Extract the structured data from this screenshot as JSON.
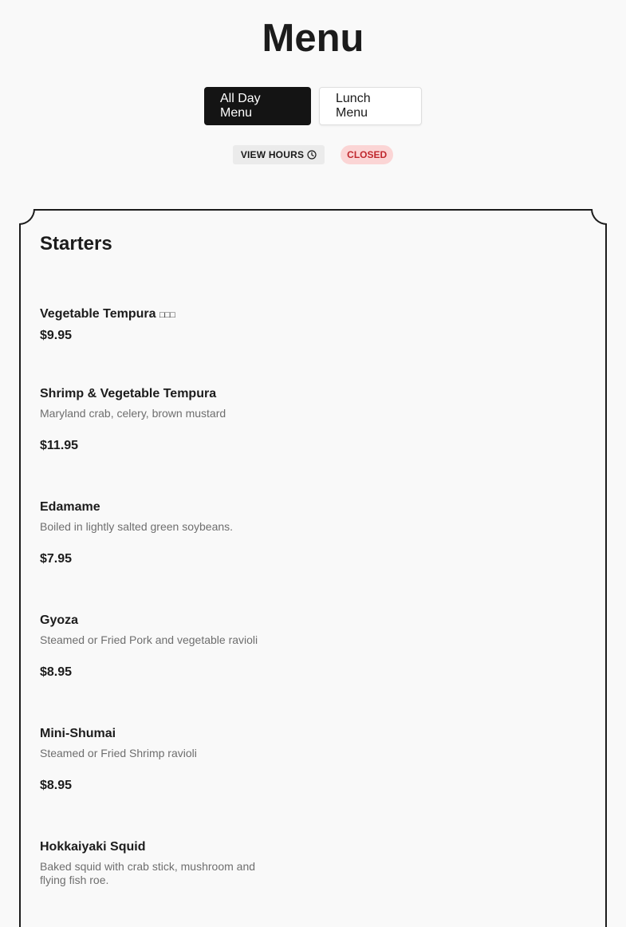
{
  "page": {
    "title": "Menu"
  },
  "tabs": [
    {
      "label": "All Day Menu",
      "active": true
    },
    {
      "label": "Lunch Menu",
      "active": false
    }
  ],
  "status": {
    "hours_label": "VIEW HOURS",
    "hours_icon": "clock-icon",
    "closed_label": "CLOSED",
    "closed_color": "#c0282e",
    "closed_bg": "#fbd5d5"
  },
  "section": {
    "title": "Starters",
    "items": [
      {
        "name": "Vegetable Tempura",
        "marker": "",
        "desc": "",
        "price": "$9.95"
      },
      {
        "name": "Shrimp & Vegetable Tempura",
        "desc": "Maryland crab, celery, brown mustard",
        "price": "$11.95"
      },
      {
        "name": "Edamame",
        "desc": "Boiled in lightly salted green soybeans.",
        "price": "$7.95"
      },
      {
        "name": "Gyoza",
        "desc": "Steamed or Fried Pork and vegetable ravioli",
        "price": "$8.95"
      },
      {
        "name": "Mini-Shumai",
        "desc": "Steamed or Fried Shrimp ravioli",
        "price": "$8.95"
      },
      {
        "name": "Hokkaiyaki Squid",
        "desc": "Baked squid with crab stick, mushroom and flying fish roe.",
        "price": ""
      }
    ]
  },
  "colors": {
    "accent_dark": "#141414",
    "background": "#f9f9f9"
  }
}
